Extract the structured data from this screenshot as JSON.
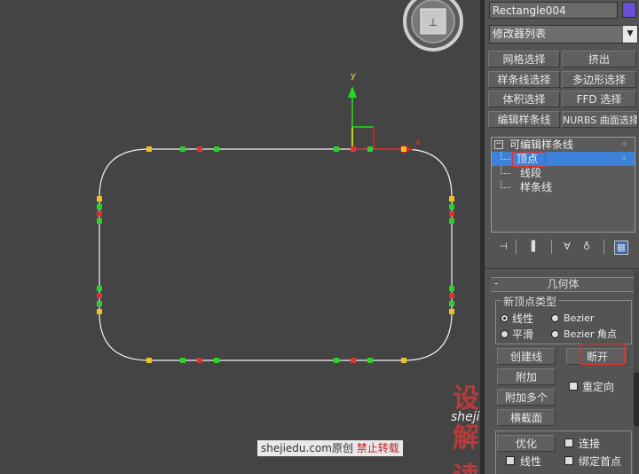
{
  "panel": {
    "object_name": "Rectangle004",
    "object_color": "#6b4fd6",
    "modifier_list": "修改器列表",
    "buttons": {
      "mesh_select": "网格选择",
      "extrude": "挤出",
      "spline_select": "样条线选择",
      "poly_select": "多边形选择",
      "volume_select": "体积选择",
      "ffd_select": "FFD 选择",
      "edit_spline": "编辑样条线",
      "nurbs_select": "NURBS 曲面选择"
    },
    "stack": {
      "root": "可编辑样条线",
      "items": [
        "顶点",
        "线段",
        "样条线"
      ]
    },
    "rollout": {
      "title": "几何体",
      "group_title": "新顶点类型",
      "radio_linear": "线性",
      "radio_bezier": "Bezier",
      "radio_smooth": "平滑",
      "radio_bezier_corner": "Bezier 角点",
      "create_line": "创建线",
      "break": "断开",
      "attach": "附加",
      "reorient": "重定向",
      "attach_multi": "附加多个",
      "cross_section": "横截面",
      "refine": "优化",
      "connect": "连接",
      "linear": "线性",
      "bind_first": "绑定首点"
    }
  },
  "viewport": {
    "axis_y": "y",
    "axis_x": "x",
    "watermark_logo": "设解读",
    "watermark_url": "shejiedu.com",
    "source_site": "shejiedu.com原创",
    "source_warning": "禁止转载",
    "colors": {
      "vertex_red": "#e23030",
      "vertex_green": "#2bd02b",
      "vertex_yellow": "#f0c020",
      "selection_box": "#e03030"
    }
  }
}
